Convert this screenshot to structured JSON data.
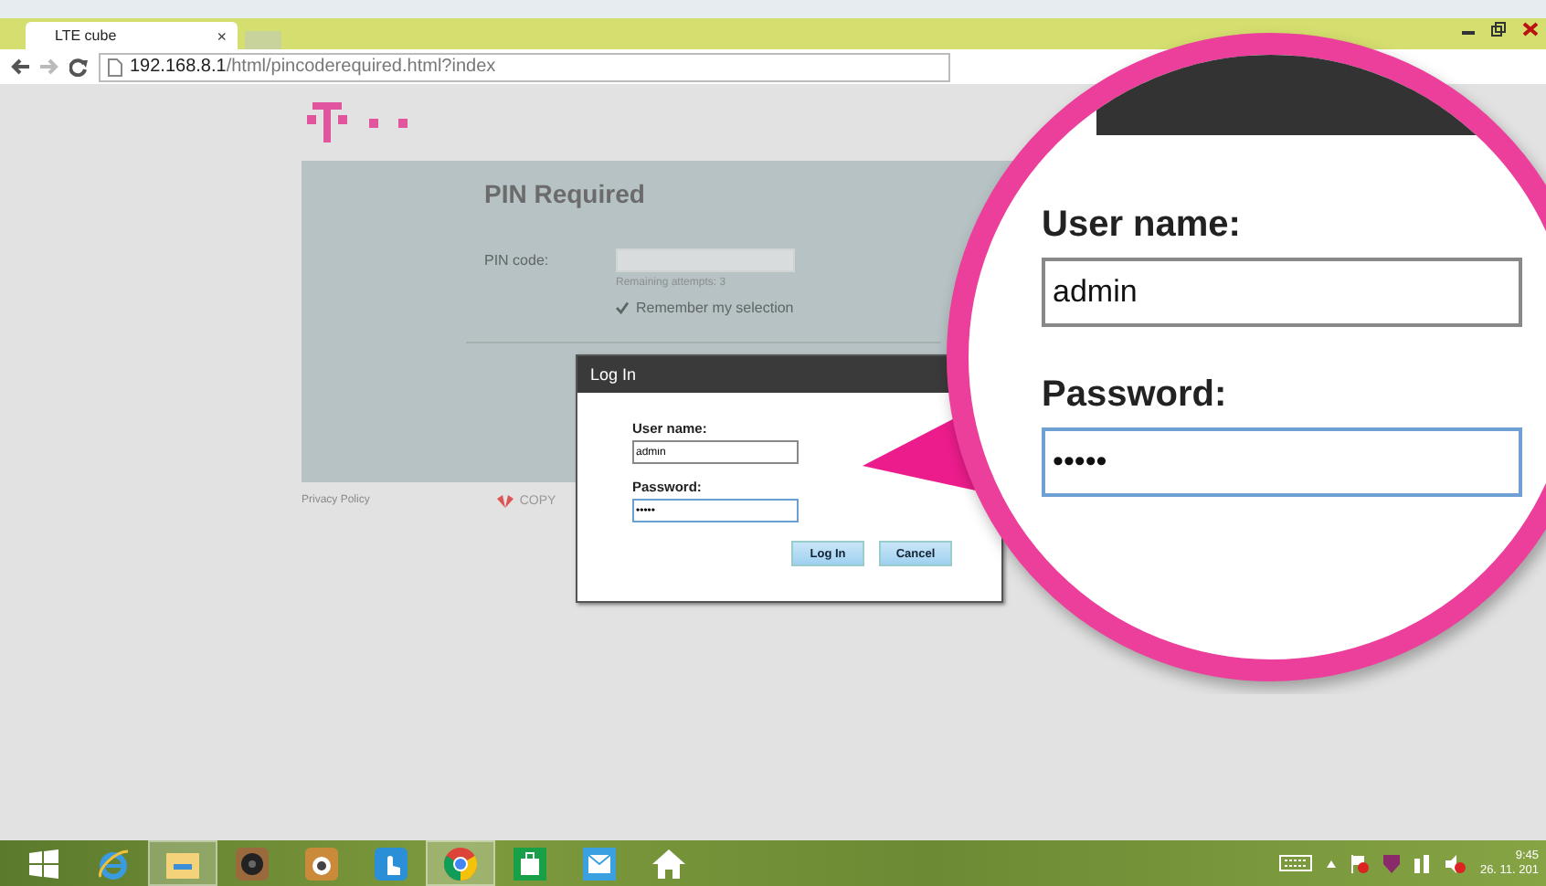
{
  "browser": {
    "tab_title": "LTE cube",
    "tab_close": "×",
    "url_host": "192.168.8.1",
    "url_path": "/html/pincoderequired.html?index"
  },
  "page": {
    "title": "PIN Required",
    "pin_label": "PIN code:",
    "remaining": "Remaining attempts: 3",
    "remember": {
      "label": "Remember my selection",
      "checked": true
    },
    "privacy_link": "Privacy Policy",
    "copyright": "COPY"
  },
  "dialog": {
    "title": "Log In",
    "username_label": "User name:",
    "username_value": "admin",
    "password_label": "Password:",
    "password_value": "•••••",
    "buttons": [
      "Log In",
      "Cancel"
    ]
  },
  "magnifier": {
    "username_label": "User name:",
    "username_value": "admin",
    "password_label": "Password:",
    "password_value": "•••••"
  },
  "taskbar": {
    "apps": [
      {
        "kind": "start",
        "selected": false
      },
      {
        "kind": "ie",
        "selected": false
      },
      {
        "kind": "explorer",
        "selected": true
      },
      {
        "kind": "speaker",
        "selected": false
      },
      {
        "kind": "camera",
        "selected": false
      },
      {
        "kind": "touch",
        "selected": false
      },
      {
        "kind": "chrome",
        "selected": true
      },
      {
        "kind": "store",
        "selected": false
      },
      {
        "kind": "mail",
        "selected": false
      },
      {
        "kind": "home",
        "selected": false
      }
    ],
    "clock": {
      "time": "9:45",
      "date": "26. 11. 201"
    }
  }
}
